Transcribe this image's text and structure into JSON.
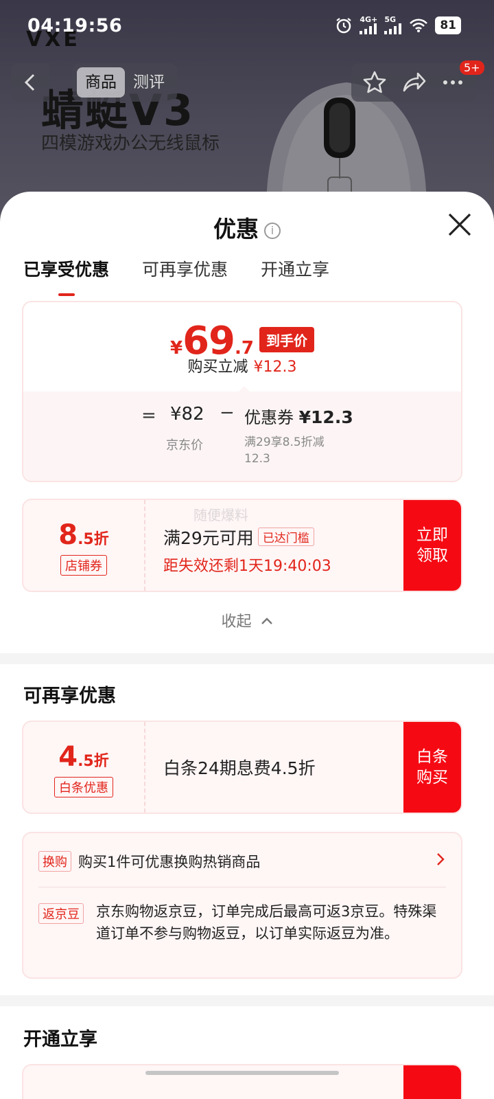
{
  "status_bar": {
    "time": "04:19:56",
    "network_1": "4G+",
    "network_2": "5G",
    "battery": "81"
  },
  "hero": {
    "brand": "VXE",
    "product_title": "蜻蜓V3",
    "product_subtitle": "四模游戏办公无线鼠标"
  },
  "top_nav": {
    "tabs": [
      {
        "label": "商品",
        "active": true
      },
      {
        "label": "测评",
        "active": false
      }
    ],
    "badge": "5+"
  },
  "sheet": {
    "title": "优惠",
    "info_icon": "i",
    "tabs": [
      {
        "label": "已享受优惠",
        "active": true
      },
      {
        "label": "可再享优惠",
        "active": false
      },
      {
        "label": "开通立享",
        "active": false
      }
    ]
  },
  "price_card": {
    "currency": "¥",
    "price_int": "69",
    "price_dec": ".7",
    "price_tag": "到手价",
    "instant_label": "购买立减",
    "instant_amount": "¥12.3",
    "equals": "=",
    "jd_price": "¥82",
    "jd_price_label": "京东价",
    "minus": "−",
    "coupon_label": "优惠券",
    "coupon_amount": "¥12.3",
    "coupon_desc": "满29享8.5折减12.3"
  },
  "coupon_shop": {
    "discount_num": "8",
    "discount_suffix": ".5折",
    "kind": "店铺券",
    "condition": "满29元可用",
    "status_tag": "已达门槛",
    "countdown": "距失效还剩1天19:40:03",
    "button": "立即领取",
    "watermark": "随便爆料"
  },
  "collapse_label": "收起",
  "section_more": {
    "title": "可再享优惠",
    "baitiao": {
      "discount_num": "4",
      "discount_suffix": ".5折",
      "kind": "白条优惠",
      "desc": "白条24期息费4.5折",
      "button": "白条购买"
    },
    "exchange_tag": "换购",
    "exchange_text": "购买1件可优惠换购热销商品",
    "jingdou_tag": "返京豆",
    "jingdou_text": "京东购物返京豆，订单完成后最高可返3京豆。特殊渠道订单不参与购物返豆，以订单实际返豆为准。"
  },
  "section_open": {
    "title": "开通立享"
  },
  "colors": {
    "brand_red": "#e1251b",
    "button_red": "#f50a14",
    "card_bg": "#fff6f6"
  }
}
